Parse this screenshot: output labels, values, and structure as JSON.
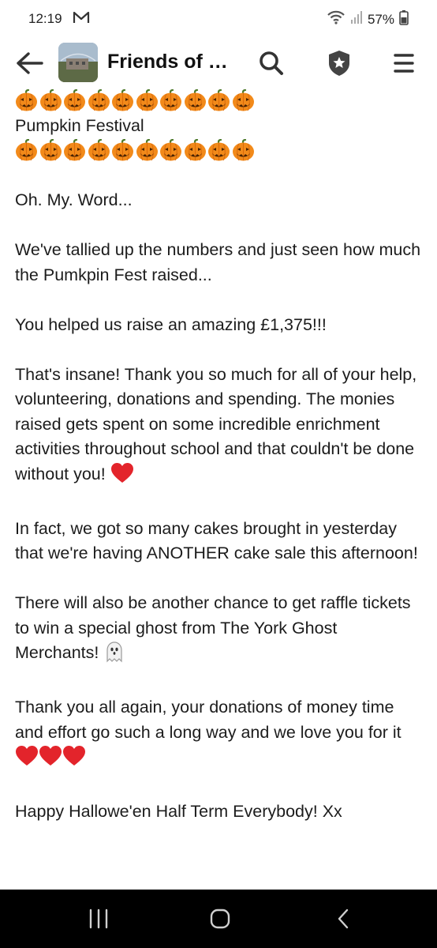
{
  "status_bar": {
    "time": "12:19",
    "battery": "57%"
  },
  "header": {
    "group_title": "Friends of K…"
  },
  "post": {
    "pumpkin_count": 10,
    "heading": "Pumpkin Festival",
    "p1": "Oh. My. Word...",
    "p2": "We've tallied up the numbers and just seen how much the Pumkpin Fest raised...",
    "p3": "You helped us raise an amazing £1,375!!!",
    "p4": "That's insane! Thank you so much for all of your help, volunteering, donations and spending. The monies raised gets spent on some incredible enrichment activities throughout school and that couldn't be done without you!",
    "p5": "In fact, we got so many cakes brought in yesterday that we're having ANOTHER cake sale this afternoon!",
    "p6": "There will also be another chance to get raffle tickets to win a special ghost from The York Ghost Merchants!",
    "p7": "Thank you all again, your donations of money time and effort go such a long way and we love you for it",
    "p8": "Happy Hallowe'en Half Term Everybody! Xx"
  },
  "colors": {
    "heart": "#e3242b",
    "pumpkin": "#f28a1a",
    "nav_bar": "#000000"
  },
  "icons": [
    "mail-icon",
    "wifi-icon",
    "signal-icon",
    "battery-icon",
    "back-arrow-icon",
    "search-icon",
    "admin-badge-icon",
    "hamburger-menu-icon",
    "jack-o-lantern-icon",
    "heart-icon",
    "ghost-icon",
    "recent-apps-icon",
    "home-icon",
    "back-chevron-icon"
  ]
}
